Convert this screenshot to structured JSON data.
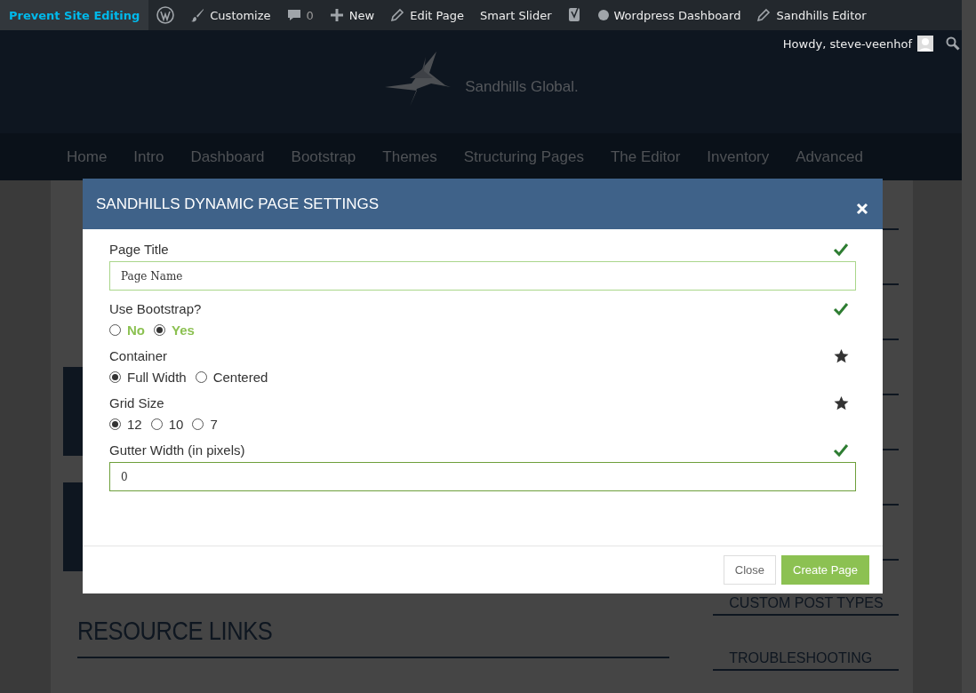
{
  "admin_bar": {
    "highlight": "Prevent Site Editing",
    "items": [
      {
        "kind": "wp"
      },
      {
        "kind": "brush",
        "label": "Customize"
      },
      {
        "kind": "comment",
        "label": "0"
      },
      {
        "kind": "plus",
        "label": "New"
      },
      {
        "kind": "pencil",
        "label": "Edit Page"
      },
      {
        "kind": "text",
        "label": "Smart Slider"
      },
      {
        "kind": "yoast"
      },
      {
        "kind": "dot",
        "label": "Wordpress Dashboard"
      },
      {
        "kind": "pencil",
        "label": "Sandhills Editor"
      }
    ],
    "greeting": "Howdy, steve-veenhof"
  },
  "logo": {
    "text": "Sandhills Global."
  },
  "nav": [
    "Home",
    "Intro",
    "Dashboard",
    "Bootstrap",
    "Themes",
    "Structuring Pages",
    "The Editor",
    "Inventory",
    "Advanced"
  ],
  "content": {
    "heading": "RESOURCE LINKS"
  },
  "sidebar": [
    "CUSTOM POST TYPES",
    "TROUBLESHOOTING"
  ],
  "modal": {
    "title": "SANDHILLS DYNAMIC PAGE SETTINGS",
    "fields": [
      {
        "kind": "text",
        "label": "Page Title",
        "valid": true,
        "value": "Page Name"
      },
      {
        "kind": "radio",
        "label": "Use Bootstrap?",
        "valid": true,
        "accent": true,
        "options": [
          {
            "label": "No",
            "selected": false
          },
          {
            "label": "Yes",
            "selected": true
          }
        ]
      },
      {
        "kind": "radio",
        "label": "Container",
        "valid": false,
        "accent": false,
        "options": [
          {
            "label": "Full Width",
            "selected": true
          },
          {
            "label": "Centered",
            "selected": false
          }
        ]
      },
      {
        "kind": "radio",
        "label": "Grid Size",
        "valid": false,
        "accent": false,
        "options": [
          {
            "label": "12",
            "selected": true
          },
          {
            "label": "10",
            "selected": false
          },
          {
            "label": "7",
            "selected": false
          }
        ]
      },
      {
        "kind": "text",
        "label": "Gutter Width (in pixels)",
        "valid": true,
        "value": "0"
      }
    ],
    "buttons": [
      {
        "kind": "default",
        "label": "Close"
      },
      {
        "kind": "primary",
        "label": "Create Page"
      }
    ]
  }
}
